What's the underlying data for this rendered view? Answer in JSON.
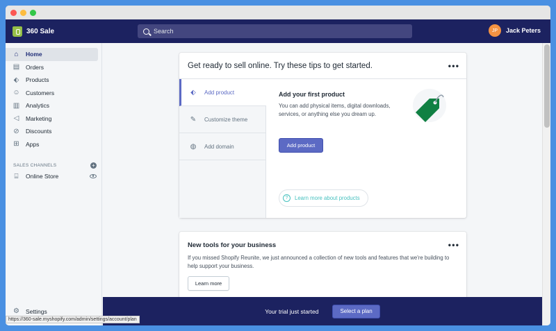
{
  "app": {
    "name": "360 Sale"
  },
  "search": {
    "placeholder": "Search"
  },
  "user": {
    "initials": "JP",
    "name": "Jack Peters"
  },
  "sidebar": {
    "items": [
      {
        "label": "Home",
        "icon": "home-icon",
        "active": true
      },
      {
        "label": "Orders",
        "icon": "orders-icon"
      },
      {
        "label": "Products",
        "icon": "tag-icon"
      },
      {
        "label": "Customers",
        "icon": "person-icon"
      },
      {
        "label": "Analytics",
        "icon": "bar-chart-icon"
      },
      {
        "label": "Marketing",
        "icon": "megaphone-icon"
      },
      {
        "label": "Discounts",
        "icon": "discount-icon"
      },
      {
        "label": "Apps",
        "icon": "apps-icon"
      }
    ],
    "channels_label": "SALES CHANNELS",
    "online_store": "Online Store",
    "settings": "Settings"
  },
  "tips_card": {
    "title": "Get ready to sell online. Try these tips to get started.",
    "tabs": [
      {
        "label": "Add product",
        "icon": "tag-icon",
        "active": true
      },
      {
        "label": "Customize theme",
        "icon": "brush-icon"
      },
      {
        "label": "Add domain",
        "icon": "globe-icon"
      }
    ],
    "content_title": "Add your first product",
    "content_desc": "You can add physical items, digital downloads, services, or anything else you dream up.",
    "primary_button": "Add product",
    "learn_more": "Learn more about products"
  },
  "tools_card": {
    "title": "New tools for your business",
    "desc": "If you missed Shopify Reunite, we just announced a collection of new tools and features that we're building to help support your business.",
    "button": "Learn more"
  },
  "trial": {
    "text": "Your trial just started",
    "button": "Select a plan"
  },
  "status_url": "https://360-sale.myshopify.com/admin/settings/account/plan",
  "colors": {
    "topbar": "#1c2260",
    "accent": "#5c6ac4",
    "teal": "#47c1bf",
    "tag_green": "#108043"
  }
}
